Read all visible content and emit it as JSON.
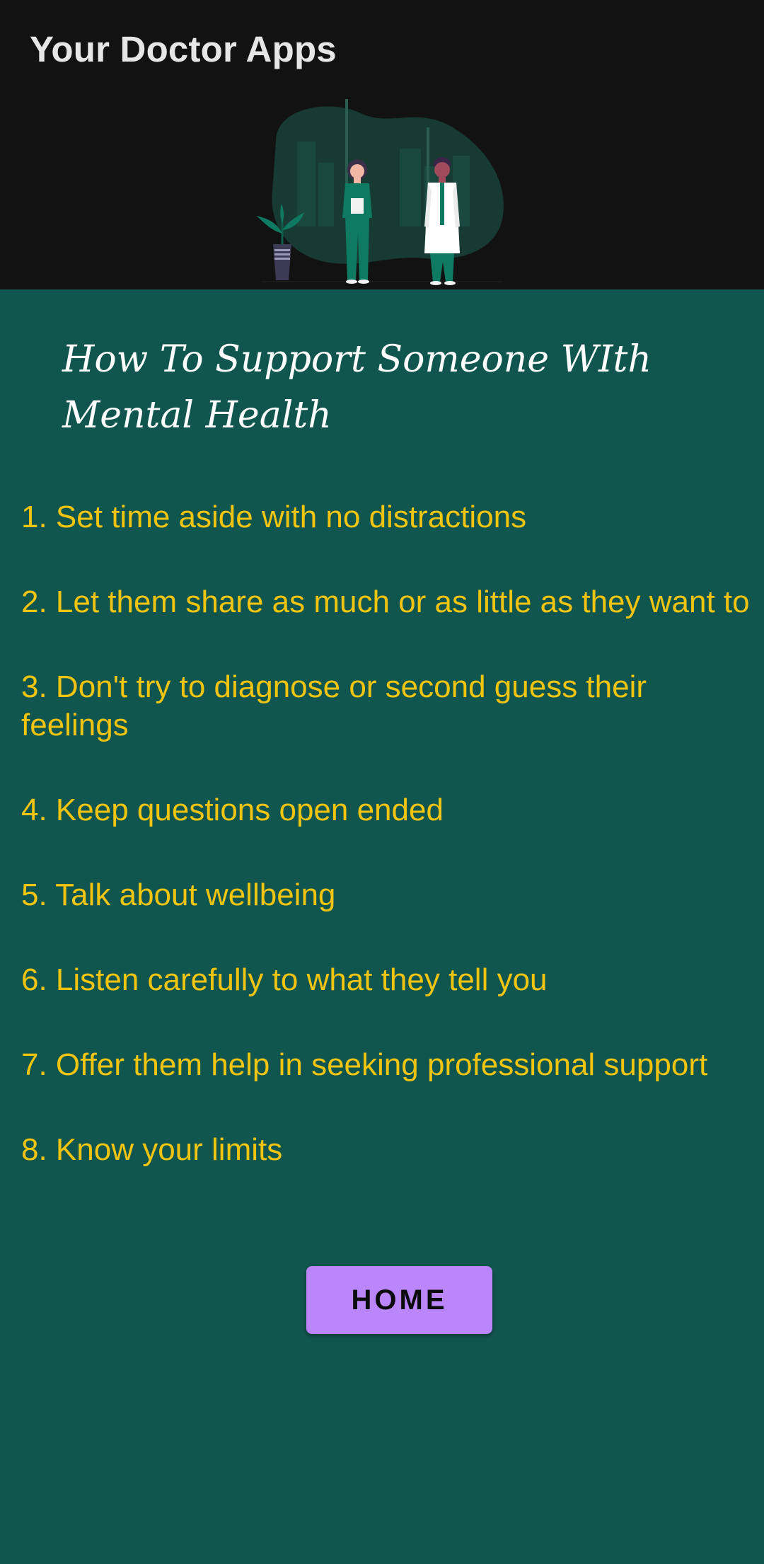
{
  "app_bar": {
    "title": "Your Doctor Apps"
  },
  "hero": {
    "illustration": "two-doctors-illustration"
  },
  "article": {
    "heading": "How To Support Someone WIth Mental Health",
    "tips": [
      "1. Set time aside with no distractions",
      "2. Let them share as much or as little as they want to",
      "3. Don't try to diagnose or second guess their feelings",
      "4. Keep questions open ended",
      "5. Talk about wellbeing",
      "6. Listen carefully to what they tell you",
      "7. Offer them help in seeking professional support",
      "8. Know your limits"
    ]
  },
  "actions": {
    "home_label": "HOME"
  },
  "colors": {
    "app_bar": "#121212",
    "background": "#11564e",
    "tip_text": "#f1c40f",
    "button": "#bb86fc"
  }
}
